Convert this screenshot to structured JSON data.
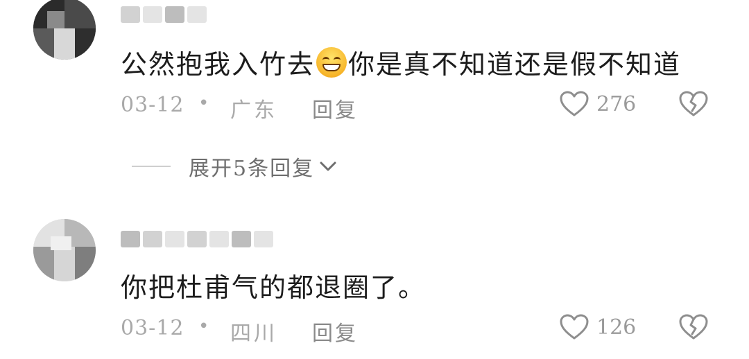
{
  "comments": [
    {
      "username": "",
      "text_before_emoji": "公然抱我入竹去",
      "emoji": "grinning-sweat-emoji",
      "text_after_emoji": "你是真不知道还是假不知道",
      "date": "03-12",
      "separator": "•",
      "region": "广东",
      "reply_label": "回复",
      "likes": "276",
      "expand_replies_label": "展开5条回复"
    },
    {
      "username": "",
      "text": "你把杜甫气的都退圈了。",
      "date": "03-12",
      "separator": "•",
      "region": "四川",
      "reply_label": "回复",
      "likes": "126"
    }
  ],
  "icons": {
    "like": "heart-outline-icon",
    "dislike": "broken-heart-icon",
    "expand": "chevron-down-icon"
  },
  "colors": {
    "text": "#1c1c1c",
    "meta": "#a9a9a9",
    "icon": "#8e8e8e"
  }
}
